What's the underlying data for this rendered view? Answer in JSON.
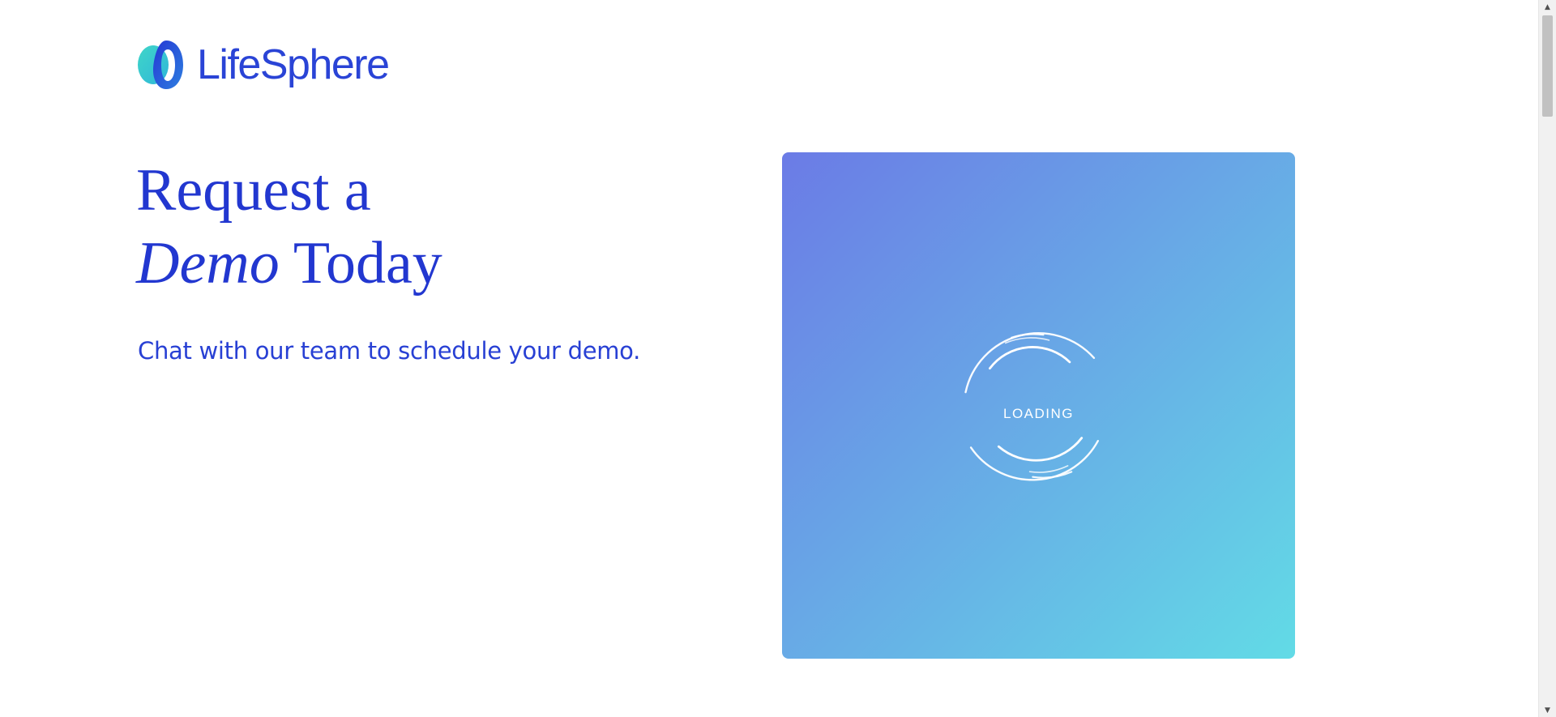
{
  "header": {
    "brand_name": "LifeSphere",
    "logo_icon": "lifesphere-logo-mark"
  },
  "hero": {
    "title_line1": "Request a",
    "title_line2_emphasis": "Demo",
    "title_line2_rest": "Today",
    "subtitle": "Chat with our team to schedule your demo."
  },
  "chat_panel": {
    "loading_text": "LOADING",
    "spinner_icon": "loading-spinner-icon",
    "gradient_colors": [
      "#6b7be6",
      "#68a6e6",
      "#62dbe6"
    ]
  },
  "colors": {
    "brand_blue": "#2237d0",
    "logo_teal": "#3fd6c8",
    "logo_blue": "#2a44d6"
  },
  "scrollbar": {
    "up_icon": "scroll-up-arrow-icon",
    "down_icon": "scroll-down-arrow-icon"
  }
}
